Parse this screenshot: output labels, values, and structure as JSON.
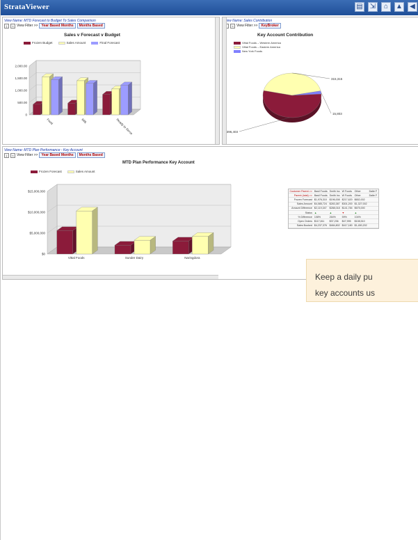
{
  "app": {
    "title": "StrataViewer"
  },
  "toolbar": {
    "icons": [
      "print-icon",
      "export-icon",
      "home-icon",
      "chart-icon",
      "back-icon"
    ]
  },
  "panel1": {
    "view_name": "View Name: MTD Forecast to Budget To Sales Comparison",
    "filter_label": "View Filter >>",
    "filter_pill_1": "Year Based Months",
    "filter_pill_2": "Months Based",
    "title": "Sales v Forecast v Budget",
    "chart_data": {
      "type": "bar",
      "categories": [
        "Food",
        "Milk",
        "Ready to Serve"
      ],
      "series": [
        {
          "name": "Frozen Budget",
          "values": [
            430,
            480,
            840
          ]
        },
        {
          "name": "Sales Amount",
          "values": [
            1560,
            1400,
            1060
          ]
        },
        {
          "name": "Final Forecast",
          "values": [
            1440,
            1290,
            1220
          ]
        }
      ],
      "ylim": [
        0,
        2000
      ],
      "yticks": [
        "2,000.00",
        "1,500.00",
        "1,000.00",
        "500.00",
        "0"
      ],
      "colors": [
        "#8b1b3a",
        "#ffffb0",
        "#9c9cff"
      ]
    }
  },
  "panel2": {
    "view_name": "View Name: Sales Contribution",
    "filter_label": "View Filter >>",
    "filter_pill": "KeyBroker",
    "title": "Key Account Contribution",
    "legend": [
      "Vittal Foods – Western America",
      "Vittal Foods – Eastern America",
      "New York Foods"
    ],
    "chart_data": {
      "type": "pie",
      "labels": [
        "Vittal Foods – Western America",
        "Vittal Foods – Eastern America",
        "New York Foods"
      ],
      "values": [
        396,
        315,
        16
      ],
      "data_labels": [
        "396,403",
        "315,315",
        "15,803"
      ],
      "colors": [
        "#8b1b3a",
        "#ffffb0",
        "#8080ff"
      ]
    }
  },
  "panel3": {
    "view_name": "View Name: MTD Plan Performance - Key Account",
    "filter_label": "View Filter >>",
    "filter_pill_1": "Year Based Months",
    "filter_pill_2": "Months Based",
    "title": "MTD Plan Performance Key Account",
    "chart_data": {
      "type": "bar",
      "categories": [
        "Vittal Foods",
        "Sunder Dairy",
        "Naringdora"
      ],
      "series": [
        {
          "name": "Frozen Forecast",
          "values": [
            5600000,
            2100000,
            3100000
          ]
        },
        {
          "name": "Sales Amount",
          "values": [
            10300000,
            3300000,
            4200000
          ]
        }
      ],
      "ylim": [
        0,
        15000000
      ],
      "yticks": [
        "$15,000,000",
        "$10,000,000",
        "$5,000,000",
        "$0"
      ],
      "colors": [
        "#8b1b3a",
        "#ffffb0"
      ]
    },
    "table": {
      "headers": [
        "Customer Parent >>",
        "Basil Foods",
        "Smith Inc",
        "W Foods",
        "Other",
        "Dalte F"
      ],
      "subheaders": [
        "Parent (total) >>",
        "Basil Foods",
        "Smith Inc",
        "W Foods",
        "Other",
        "Dalte F"
      ],
      "rows": [
        [
          "Frozen Forecast",
          "$1,976,310",
          "$196,008",
          "$217,620",
          "$652,002",
          ""
        ],
        [
          "Sales Amount",
          "$4,085,724",
          "$283,387",
          "$301,200",
          "$1,327,002",
          ""
        ],
        [
          "Amount Difference",
          "$2,119,347",
          "$288,018",
          "$141,784",
          "$675,000",
          ""
        ],
        [
          "Status",
          "▲",
          "▲",
          "▼",
          "▲",
          ""
        ],
        [
          "% Difference",
          "108%",
          "264%",
          "59%",
          "104%",
          ""
        ],
        [
          "Open Orders",
          "$117,811",
          "$37,236",
          "$47,995",
          "$108,510",
          ""
        ],
        [
          "Sales Booked",
          "$4,237,376",
          "$484,802",
          "$417,180",
          "$1,450,202",
          ""
        ]
      ]
    }
  },
  "callout": {
    "text": "Keep a daily pu\nkey accounts us"
  }
}
